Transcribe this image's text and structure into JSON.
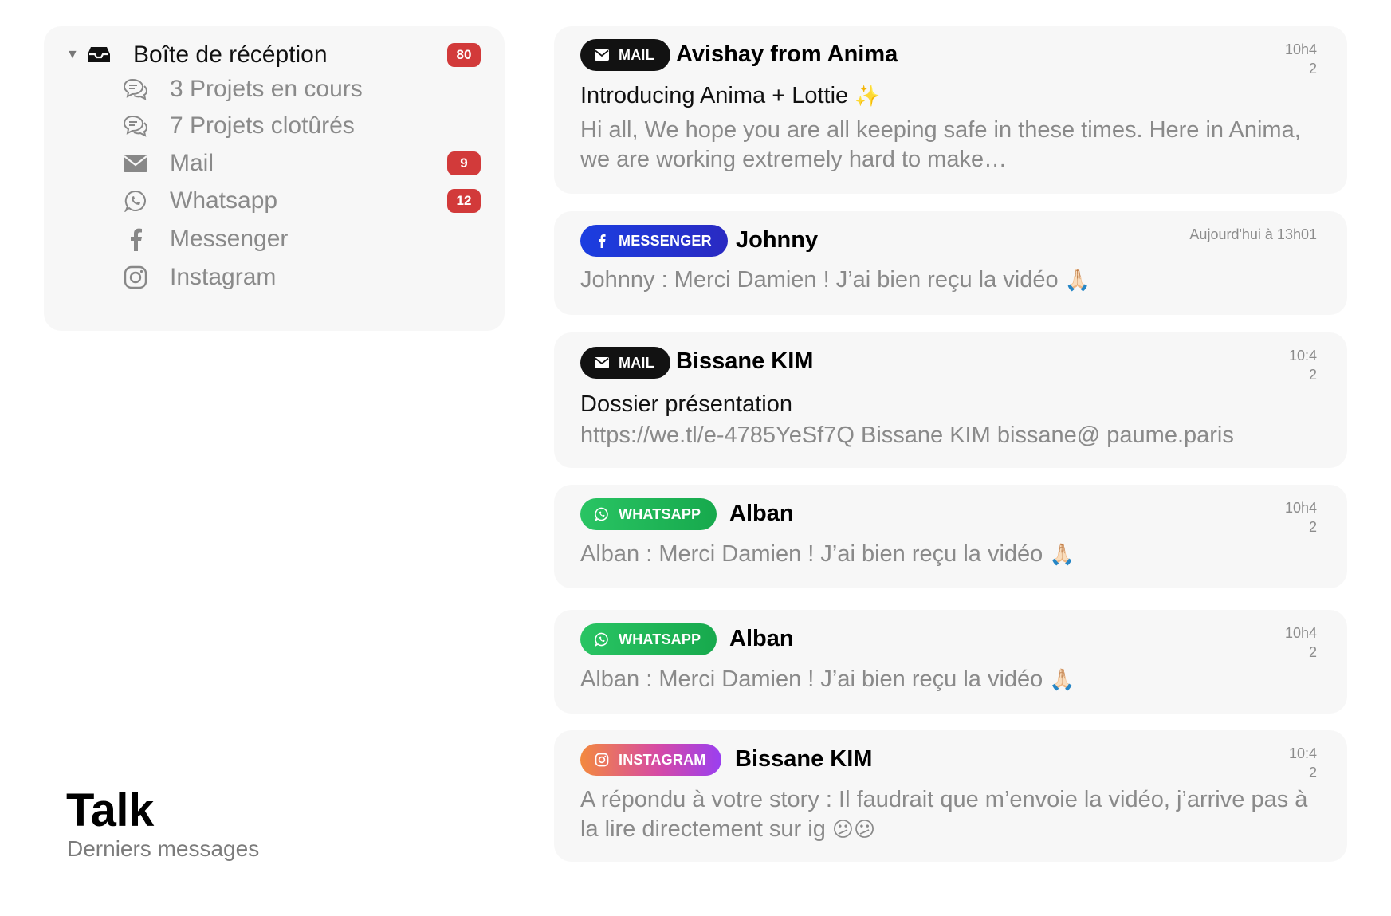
{
  "sidebar": {
    "root": {
      "label": "Boîte de récéption",
      "badge": "80",
      "icon": "inbox-tray-icon",
      "caret": "▼"
    },
    "items": [
      {
        "label": "3 Projets en cours",
        "icon": "chat-bubbles-icon",
        "badge": ""
      },
      {
        "label": "7 Projets clotûrés",
        "icon": "chat-bubbles-icon",
        "badge": ""
      },
      {
        "label": "Mail",
        "icon": "envelope-icon",
        "badge": "9"
      },
      {
        "label": "Whatsapp",
        "icon": "whatsapp-icon",
        "badge": "12"
      },
      {
        "label": "Messenger",
        "icon": "facebook-icon",
        "badge": ""
      },
      {
        "label": "Instagram",
        "icon": "instagram-icon",
        "badge": ""
      }
    ]
  },
  "caption": {
    "title": "Talk",
    "subtitle": "Derniers messages"
  },
  "messages": [
    {
      "channel": "MAIL",
      "sender": "Avishay from Anima",
      "time_line1": "10h4",
      "time_line2": "2",
      "subject": "Introducing Anima + Lottie",
      "subject_emoji": "✨",
      "preview": "Hi all, We hope you are all keeping safe in these times. Here in Anima, we are working extremely hard to make…"
    },
    {
      "channel": "MESSENGER",
      "sender": "Johnny",
      "time_line1": "Aujourd'hui à 13h01",
      "preview": "Johnny : Merci Damien ! J’ai bien reçu la vidéo",
      "preview_emoji": "🙏🏻"
    },
    {
      "channel": "MAIL",
      "sender": "Bissane KIM",
      "time_line1": "10:4",
      "time_line2": "2",
      "subject": "Dossier présentation",
      "preview": "https://we.tl/e-4785YeSf7Q Bissane KIM bissane@ paume.paris"
    },
    {
      "channel": "WHATSAPP",
      "sender": "Alban",
      "time_line1": "10h4",
      "time_line2": "2",
      "preview": "Alban : Merci Damien ! J’ai bien reçu la vidéo",
      "preview_emoji": "🙏🏻"
    },
    {
      "channel": "WHATSAPP",
      "sender": "Alban",
      "time_line1": "10h4",
      "time_line2": "2",
      "preview": "Alban : Merci Damien ! J’ai bien reçu la vidéo",
      "preview_emoji": "🙏🏻"
    },
    {
      "channel": "INSTAGRAM",
      "sender": "Bissane KIM",
      "time_line1": "10:4",
      "time_line2": "2",
      "preview": "A répondu à votre story : Il faudrait que m’envoie la vidéo, j’arrive pas à la lire directement sur ig",
      "preview_emoji": "😕😕"
    }
  ],
  "colors": {
    "badge": "#d23a3a",
    "mail_chip": "#121212",
    "messenger_chip": "#1b3ee0",
    "whatsapp_chip": "#22b85a",
    "instagram_chip_start": "#f3893e",
    "instagram_chip_end": "#9a3ff0",
    "card_bg": "#f7f7f7"
  }
}
